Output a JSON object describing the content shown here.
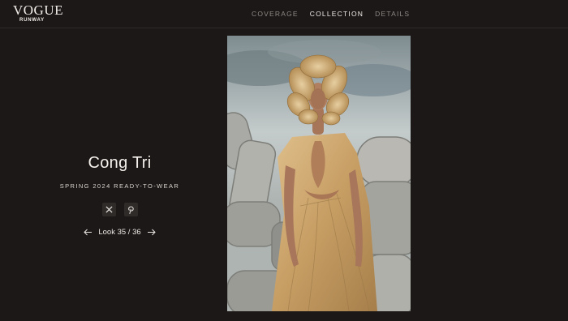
{
  "logo": {
    "brand": "VOGUE",
    "sub": "RUNWAY"
  },
  "nav": {
    "items": [
      {
        "label": "COVERAGE",
        "active": false
      },
      {
        "label": "COLLECTION",
        "active": true
      },
      {
        "label": "DETAILS",
        "active": false
      }
    ]
  },
  "show": {
    "designer": "Cong Tri",
    "season": "SPRING 2024 READY-TO-WEAR",
    "look_label": "Look 35 / 36"
  },
  "icons": {
    "share_x": "x-icon",
    "share_pinterest": "pinterest-icon",
    "prev": "arrow-left-icon",
    "next": "arrow-right-icon"
  },
  "photo": {
    "subject": "runway look photo"
  },
  "colors": {
    "background": "#1b1817",
    "text": "#e9e6e2",
    "muted": "#8e8985",
    "gown": "#c9a26a"
  }
}
